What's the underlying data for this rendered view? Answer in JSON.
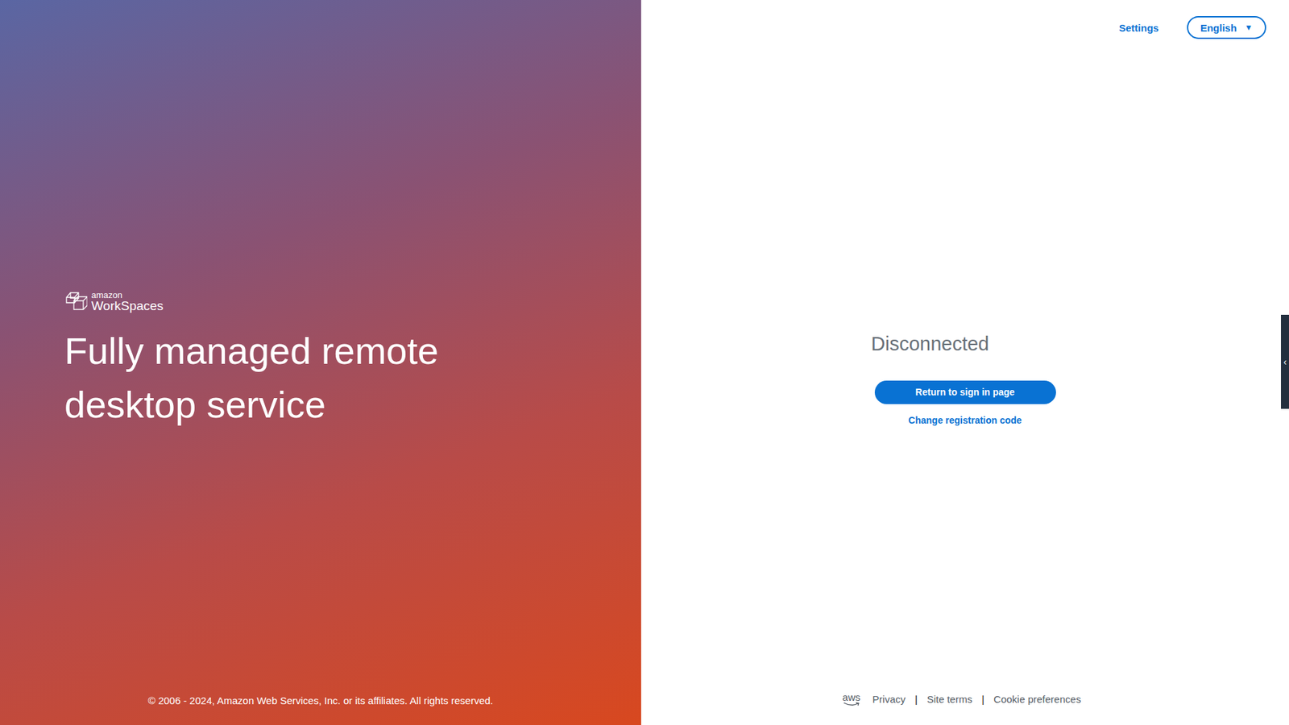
{
  "hero": {
    "brand_top": "amazon",
    "brand_name": "WorkSpaces",
    "heading": "Fully managed remote desktop service",
    "copyright": "© 2006 - 2024, Amazon Web Services, Inc. or its affiliates. All rights reserved."
  },
  "header": {
    "settings": "Settings",
    "language": "English",
    "language_caret": "▼"
  },
  "status": {
    "title": "Disconnected",
    "primary_button": "Return to sign in page",
    "secondary_link": "Change registration code"
  },
  "footer": {
    "logo": "aws",
    "links": [
      "Privacy",
      "Site terms",
      "Cookie preferences"
    ],
    "separator": "|"
  },
  "side_tab": {
    "glyph": "‹",
    "expanded": false
  }
}
